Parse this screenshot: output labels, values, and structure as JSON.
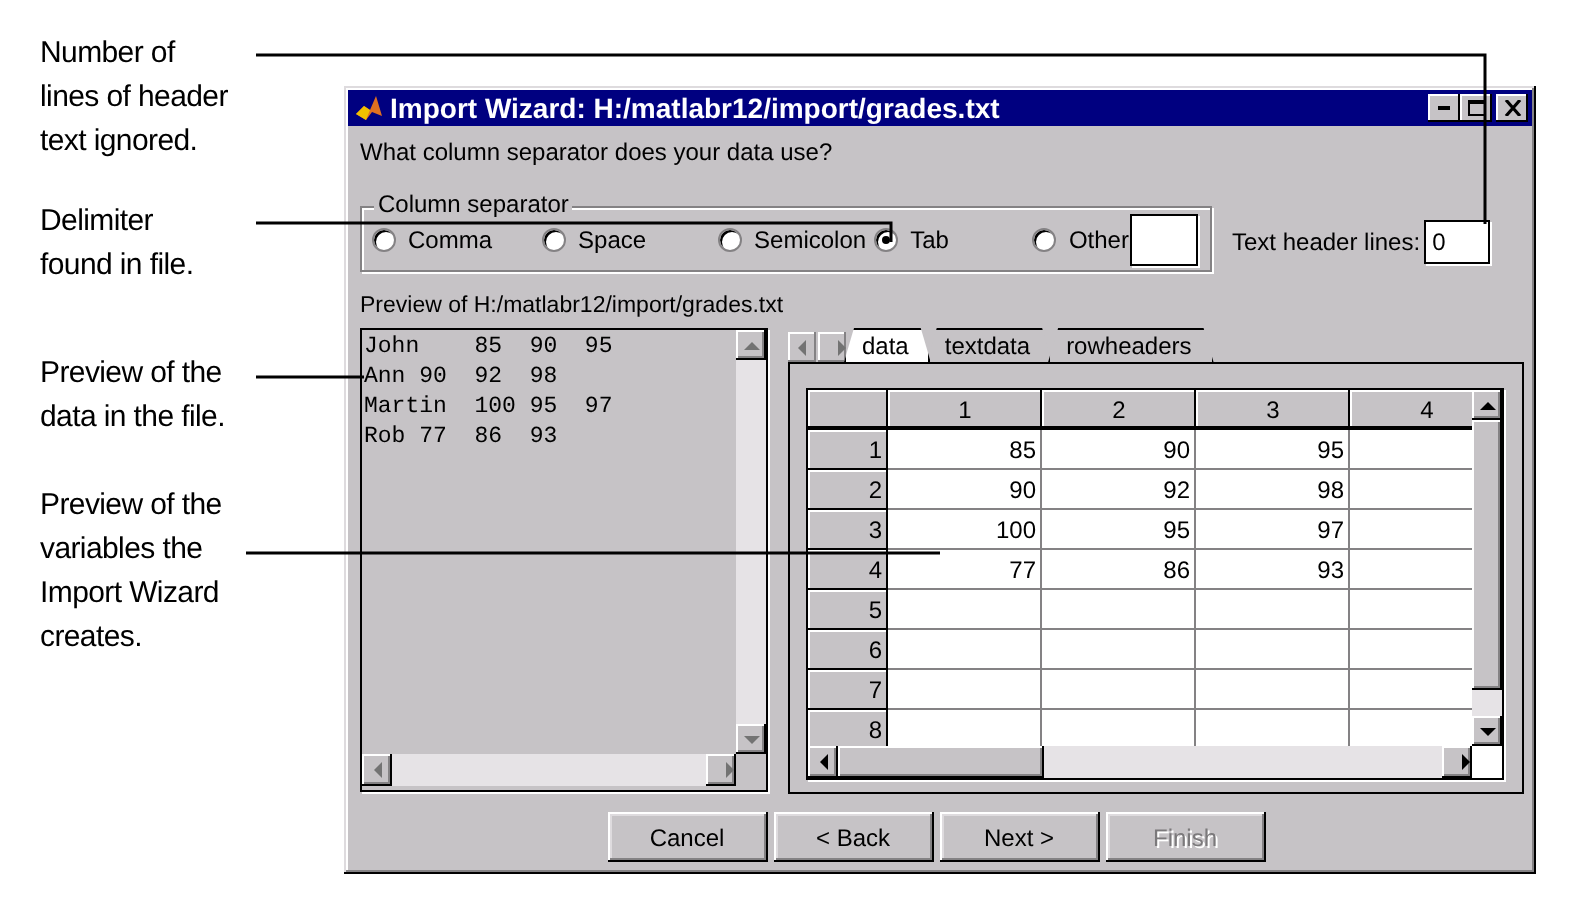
{
  "annotations": [
    {
      "text": "Number of\nlines of header\ntext ignored."
    },
    {
      "text": "Delimiter\nfound in file."
    },
    {
      "text": "Preview of the\ndata in the file."
    },
    {
      "text": "Preview of the\nvariables the\nImport Wizard\ncreates."
    }
  ],
  "window": {
    "title": "Import Wizard: H:/matlabr12/import/grades.txt",
    "question": "What column separator does your data use?",
    "separator": {
      "legend": "Column separator",
      "options": [
        {
          "label": "Comma",
          "selected": false
        },
        {
          "label": "Space",
          "selected": false
        },
        {
          "label": "Semicolon",
          "selected": false
        },
        {
          "label": "Tab",
          "selected": true
        },
        {
          "label": "Other",
          "selected": false
        }
      ]
    },
    "header_lines": {
      "label": "Text header lines:",
      "value": "0"
    },
    "preview": {
      "label": "Preview of H:/matlabr12/import/grades.txt",
      "lines": [
        "John\t85\t90\t95",
        "Ann\t90\t92\t98",
        "Martin\t100\t95\t97",
        "Rob\t77\t86\t93"
      ]
    },
    "tabs": [
      {
        "label": "data",
        "selected": true
      },
      {
        "label": "textdata",
        "selected": false
      },
      {
        "label": "rowheaders",
        "selected": false
      }
    ],
    "table": {
      "columns": [
        "1",
        "2",
        "3",
        "4"
      ],
      "rows": [
        {
          "header": "1",
          "cells": [
            "85",
            "90",
            "95"
          ]
        },
        {
          "header": "2",
          "cells": [
            "90",
            "92",
            "98"
          ]
        },
        {
          "header": "3",
          "cells": [
            "100",
            "95",
            "97"
          ]
        },
        {
          "header": "4",
          "cells": [
            "77",
            "86",
            "93"
          ]
        },
        {
          "header": "5",
          "cells": []
        },
        {
          "header": "6",
          "cells": []
        },
        {
          "header": "7",
          "cells": []
        },
        {
          "header": "8",
          "cells": []
        }
      ]
    },
    "buttons": [
      {
        "label": "Cancel",
        "disabled": false
      },
      {
        "label": "< Back",
        "disabled": false
      },
      {
        "label": "Next >",
        "disabled": false
      },
      {
        "label": "Finish",
        "disabled": true
      }
    ]
  }
}
